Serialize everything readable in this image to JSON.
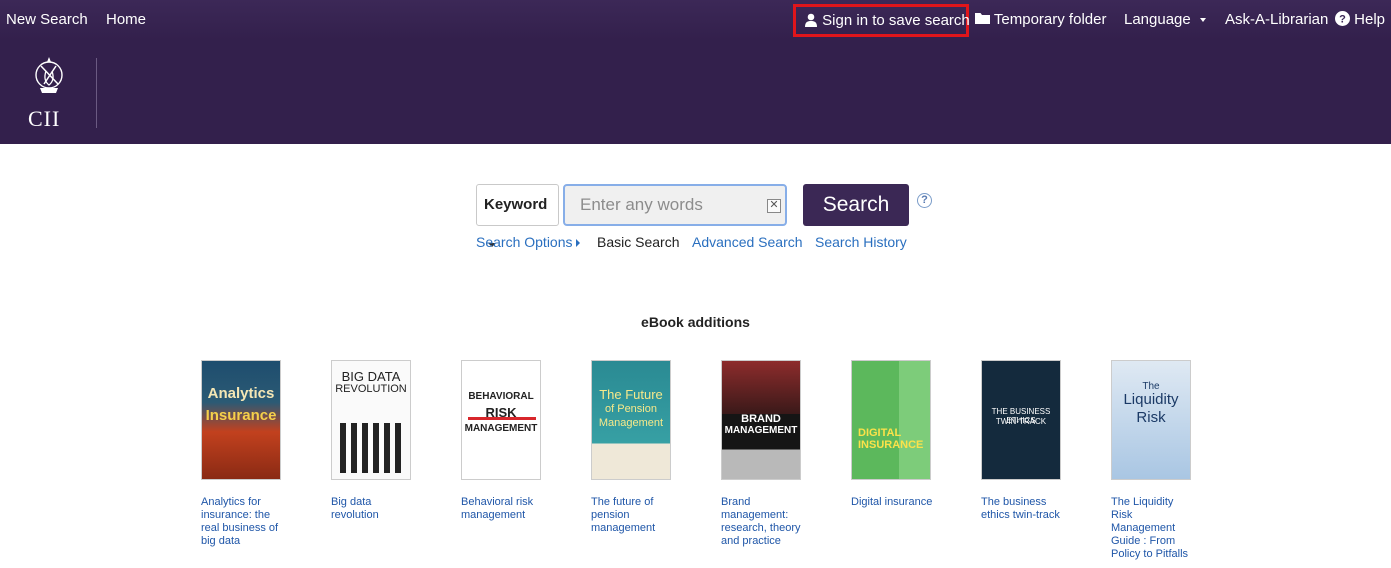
{
  "nav": {
    "new_search": "New Search",
    "home": "Home",
    "sign_in": "Sign in to save search",
    "temporary_folder": "Temporary folder",
    "language": "Language",
    "ask_librarian": "Ask-A-Librarian",
    "help": "Help"
  },
  "brand": {
    "logo_text": "CII"
  },
  "search": {
    "type_selected": "Keyword",
    "placeholder": "Enter any words",
    "button": "Search",
    "help_icon_text": "?"
  },
  "sublinks": {
    "search_options": "Search Options",
    "basic_search": "Basic Search",
    "advanced_search": "Advanced Search",
    "search_history": "Search History"
  },
  "ebooks": {
    "heading": "eBook additions",
    "items": [
      {
        "title": "Analytics for insurance: the real business of big data",
        "cover_lines": [
          "Analytics",
          "Insurance"
        ]
      },
      {
        "title": "Big data revolution",
        "cover_lines": [
          "BIG DATA",
          "REVOLUTION"
        ]
      },
      {
        "title": "Behavioral risk management",
        "cover_lines": [
          "BEHAVIORAL",
          "RISK",
          "MANAGEMENT"
        ]
      },
      {
        "title": "The future of pension management",
        "cover_lines": [
          "The Future",
          "of Pension",
          "Management"
        ]
      },
      {
        "title": "Brand management: research, theory and practice",
        "cover_lines": [
          "BRAND",
          "MANAGEMENT"
        ]
      },
      {
        "title": "Digital insurance",
        "cover_lines": [
          "DIGITAL",
          "INSURANCE"
        ]
      },
      {
        "title": "The business ethics twin-track",
        "cover_lines": [
          "THE BUSINESS ETHICS",
          "TWIN-TRACK"
        ]
      },
      {
        "title": "The Liquidity Risk Management Guide : From Policy to Pitfalls",
        "cover_lines": [
          "The",
          "Liquidity",
          "Risk"
        ]
      }
    ]
  },
  "colors": {
    "nav_bg": "#3c2857",
    "header_bg": "#33204c",
    "highlight_border": "#e0151b",
    "link": "#2a6fbf",
    "button_bg": "#3b2855"
  }
}
